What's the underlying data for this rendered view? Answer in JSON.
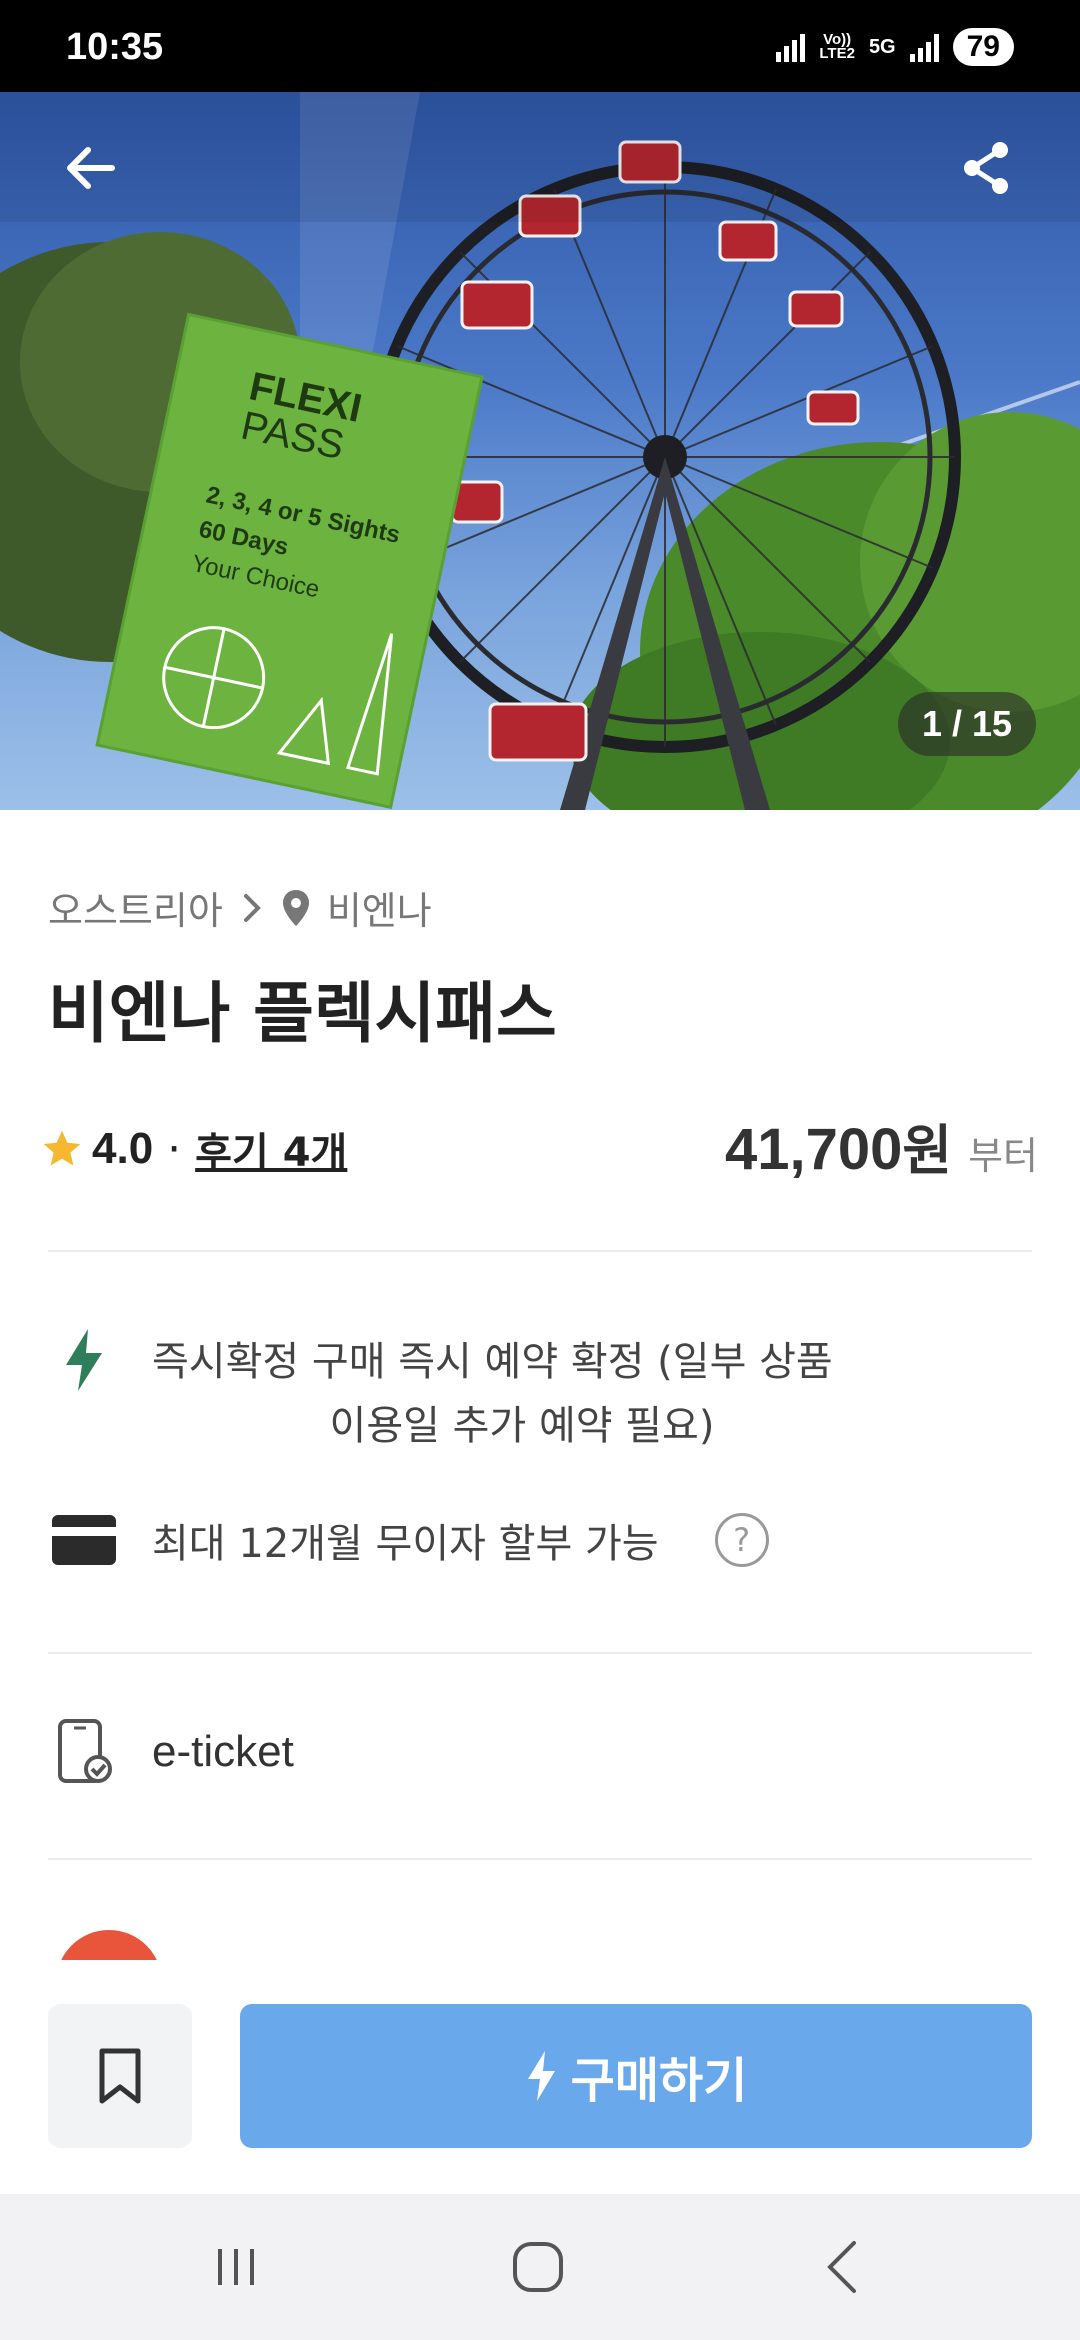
{
  "status_bar": {
    "time": "10:35",
    "network_label_top": "Vo))",
    "network_label_bottom": "LTE2",
    "network_5g": "5G",
    "battery": "79"
  },
  "hero": {
    "image_counter": "1 / 15",
    "sign_text": {
      "line1": "FLEXI",
      "line2": "PASS",
      "line3": "2, 3, 4 or 5 Sights",
      "line4": "60 Days",
      "line5": "Your Choice"
    },
    "back_icon": "arrow-left-icon",
    "share_icon": "share-icon"
  },
  "product": {
    "breadcrumb_country": "오스트리아",
    "breadcrumb_city": "비엔나",
    "title": "비엔나 플렉시패스",
    "rating": "4.0",
    "rating_separator": "·",
    "reviews_label": "후기 4개",
    "price_amount": "41,700",
    "price_currency": "원",
    "price_suffix": "부터"
  },
  "features": {
    "instant_line1": "즉시확정 구매 즉시 예약 확정 (일부 상품",
    "instant_line2": "이용일 추가 예약 필요)",
    "installment": "최대 12개월 무이자 할부 가능",
    "help_glyph": "?",
    "ticket_type": "e-ticket"
  },
  "actions": {
    "buy_label": "구매하기"
  },
  "colors": {
    "primary_button": "#69a8ea",
    "bolt_green": "#2e7d5b",
    "badge_orange": "#e8553b"
  }
}
